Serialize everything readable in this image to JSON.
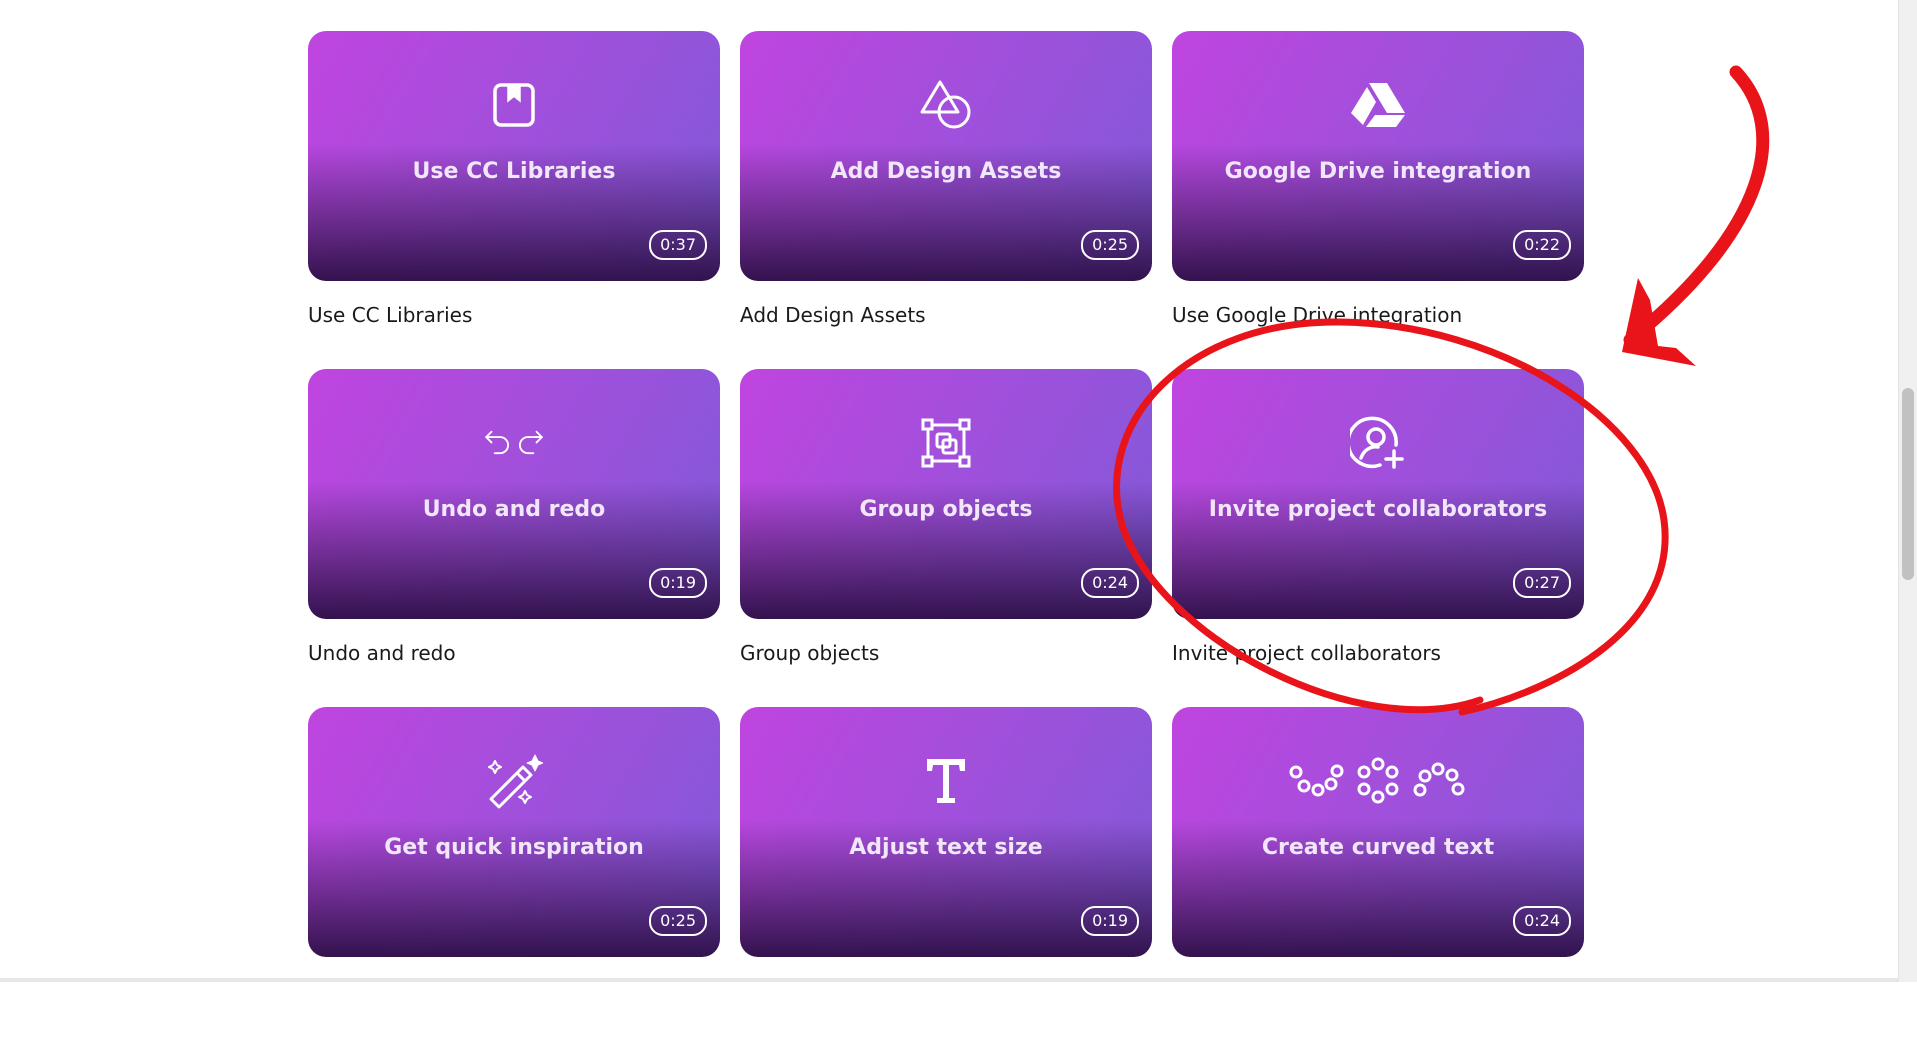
{
  "tutorials": [
    {
      "title": "Use CC Libraries",
      "duration": "0:37",
      "caption": "Use CC Libraries",
      "icon": "book-icon"
    },
    {
      "title": "Add Design Assets",
      "duration": "0:25",
      "caption": "Add Design Assets",
      "icon": "shapes-icon"
    },
    {
      "title": "Google Drive integration",
      "duration": "0:22",
      "caption": "Use Google Drive integration",
      "icon": "google-drive-icon"
    },
    {
      "title": "Undo and redo",
      "duration": "0:19",
      "caption": "Undo and redo",
      "icon": "undo-redo-icon"
    },
    {
      "title": "Group objects",
      "duration": "0:24",
      "caption": "Group objects",
      "icon": "group-objects-icon"
    },
    {
      "title": "Invite project collaborators",
      "duration": "0:27",
      "caption": "Invite project collaborators",
      "icon": "add-user-icon"
    },
    {
      "title": "Get quick inspiration",
      "duration": "0:25",
      "caption": "",
      "icon": "magic-wand-icon"
    },
    {
      "title": "Adjust text size",
      "duration": "0:19",
      "caption": "",
      "icon": "text-icon"
    },
    {
      "title": "Create curved text",
      "duration": "0:24",
      "caption": "",
      "icon": "curved-text-icon"
    }
  ],
  "annotation": {
    "color": "#e8141a",
    "highlighted_tutorial": "Invite project collaborators"
  }
}
